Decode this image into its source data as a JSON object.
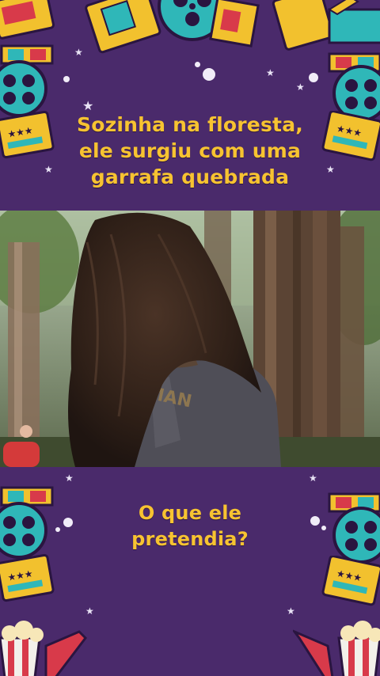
{
  "top_caption": {
    "line1": "Sozinha na floresta,",
    "line2": "ele surgiu com uma",
    "line3": "garrafa quebrada"
  },
  "bottom_caption": {
    "line1": "O que ele",
    "line2": "pretendia?"
  },
  "video": {
    "shirt_print_text": "MAN"
  },
  "colors": {
    "background": "#4a2a6b",
    "caption": "#f7c331",
    "ticket_yellow": "#f2c12e",
    "reel_teal": "#2fb7b8",
    "popcorn_red": "#d83a4a"
  },
  "icons": [
    "film-reel-icon",
    "ticket-icon",
    "clapperboard-icon",
    "popcorn-icon",
    "star-icon",
    "3d-glasses-icon"
  ]
}
